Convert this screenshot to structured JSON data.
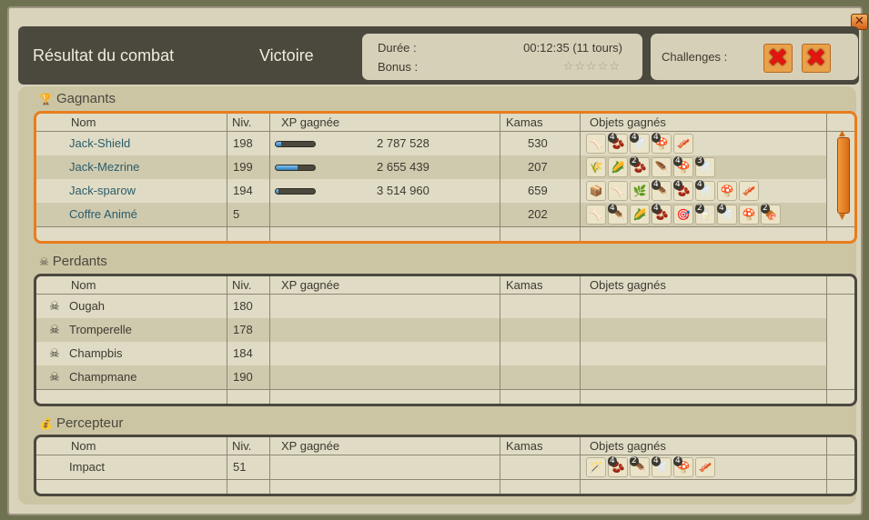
{
  "window": {
    "close_label": "✕",
    "title": "Résultat du combat",
    "result": "Victoire",
    "duration_label": "Durée :",
    "duration_value": "00:12:35 (11 tours)",
    "bonus_label": "Bonus :",
    "bonus_stars": "☆☆☆☆☆",
    "challenges_label": "Challenges :"
  },
  "columns": {
    "name": "Nom",
    "level": "Niv.",
    "xp": "XP gagnée",
    "kamas": "Kamas",
    "items": "Objets gagnés"
  },
  "winners": {
    "title": "Gagnants",
    "rows": [
      {
        "name": "Jack-Shield",
        "level": "198",
        "xp": "2 787 528",
        "xp_fill": 0.15,
        "kamas": "530",
        "items": [
          {
            "icon": "🦴",
            "q": ""
          },
          {
            "icon": "🫘",
            "q": "4"
          },
          {
            "icon": "🦷",
            "q": "4"
          },
          {
            "icon": "🍄",
            "q": "4"
          },
          {
            "icon": "🥓",
            "q": ""
          }
        ]
      },
      {
        "name": "Jack-Mezrine",
        "level": "199",
        "xp": "2 655 439",
        "xp_fill": 0.55,
        "kamas": "207",
        "items": [
          {
            "icon": "🌾",
            "q": ""
          },
          {
            "icon": "🌽",
            "q": ""
          },
          {
            "icon": "🫘",
            "q": "2"
          },
          {
            "icon": "🪶",
            "q": ""
          },
          {
            "icon": "🍄",
            "q": "4"
          },
          {
            "icon": "🦷",
            "q": "3"
          }
        ]
      },
      {
        "name": "Jack-sparow",
        "level": "194",
        "xp": "3 514 960",
        "xp_fill": 0.08,
        "kamas": "659",
        "items": [
          {
            "icon": "📦",
            "q": ""
          },
          {
            "icon": "🦴",
            "q": ""
          },
          {
            "icon": "🌿",
            "q": ""
          },
          {
            "icon": "🪶",
            "q": "4"
          },
          {
            "icon": "🫘",
            "q": "4"
          },
          {
            "icon": "🦷",
            "q": "4"
          },
          {
            "icon": "🍄",
            "q": ""
          },
          {
            "icon": "🥓",
            "q": ""
          }
        ]
      },
      {
        "name": "Coffre Animé",
        "level": "5",
        "xp": "",
        "xp_fill": null,
        "kamas": "202",
        "items": [
          {
            "icon": "🦴",
            "q": ""
          },
          {
            "icon": "🪶",
            "q": "4"
          },
          {
            "icon": "🌽",
            "q": ""
          },
          {
            "icon": "🫘",
            "q": "4"
          },
          {
            "icon": "🎯",
            "q": ""
          },
          {
            "icon": "🥛",
            "q": "2"
          },
          {
            "icon": "🦷",
            "q": "4"
          },
          {
            "icon": "🍄",
            "q": ""
          },
          {
            "icon": "🍖",
            "q": "2"
          }
        ]
      }
    ]
  },
  "losers": {
    "title": "Perdants",
    "rows": [
      {
        "name": "Ougah",
        "level": "180"
      },
      {
        "name": "Tromperelle",
        "level": "178"
      },
      {
        "name": "Champbis",
        "level": "184"
      },
      {
        "name": "Champmane",
        "level": "190"
      }
    ]
  },
  "collector": {
    "title": "Percepteur",
    "rows": [
      {
        "name": "Impact",
        "level": "51",
        "items": [
          {
            "icon": "🪄",
            "q": ""
          },
          {
            "icon": "🫘",
            "q": "4"
          },
          {
            "icon": "🪶",
            "q": "2"
          },
          {
            "icon": "🦷",
            "q": "4"
          },
          {
            "icon": "🍄",
            "q": "4"
          },
          {
            "icon": "🥓",
            "q": ""
          }
        ]
      }
    ]
  },
  "colors": {
    "accent": "#e87d1d",
    "header_bg": "#4b483e",
    "link": "#2a5d6a"
  }
}
